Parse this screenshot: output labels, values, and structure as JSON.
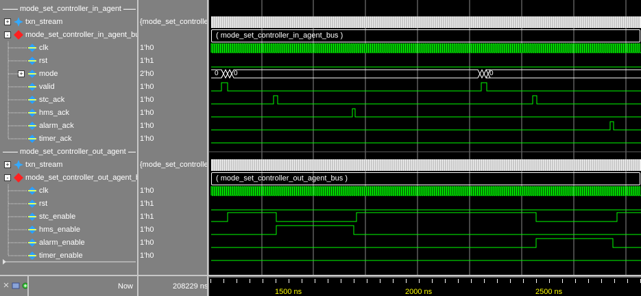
{
  "groups": [
    {
      "label": "mode_set_controller_in_agent"
    },
    {
      "label": "mode_set_controller_out_agent"
    }
  ],
  "signals": [
    {
      "name": "txn_stream",
      "value": "{mode_set_controller...",
      "icon": "stream-icon",
      "expand": "+"
    },
    {
      "name": "mode_set_controller_in_agent_bus",
      "value": "",
      "icon": "bus-icon",
      "expand": "-"
    },
    {
      "name": "clk",
      "value": "1'h0",
      "icon": "wire-icon"
    },
    {
      "name": "rst",
      "value": "1'h1",
      "icon": "wire-icon"
    },
    {
      "name": "mode",
      "value": "2'h0",
      "icon": "wire-icon",
      "expand": "+"
    },
    {
      "name": "valid",
      "value": "1'h0",
      "icon": "wire-icon"
    },
    {
      "name": "stc_ack",
      "value": "1'h0",
      "icon": "wire-icon"
    },
    {
      "name": "hms_ack",
      "value": "1'h0",
      "icon": "wire-icon"
    },
    {
      "name": "alarm_ack",
      "value": "1'h0",
      "icon": "wire-icon"
    },
    {
      "name": "timer_ack",
      "value": "1'h0",
      "icon": "wire-icon"
    },
    {
      "name": "txn_stream",
      "value": "{mode_set_controlle...",
      "icon": "stream-icon",
      "expand": "+"
    },
    {
      "name": "mode_set_controller_out_agent_bus",
      "value": "",
      "icon": "bus-icon",
      "expand": "-"
    },
    {
      "name": "clk",
      "value": "1'h0",
      "icon": "wire-icon"
    },
    {
      "name": "rst",
      "value": "1'h1",
      "icon": "wire-icon"
    },
    {
      "name": "stc_enable",
      "value": "1'h1",
      "icon": "wire-icon"
    },
    {
      "name": "hms_enable",
      "value": "1'h0",
      "icon": "wire-icon"
    },
    {
      "name": "alarm_enable",
      "value": "1'h0",
      "icon": "wire-icon"
    },
    {
      "name": "timer_enable",
      "value": "1'h0",
      "icon": "wire-icon"
    }
  ],
  "wave_labels": {
    "in_bus": "( mode_set_controller_in_agent_bus )",
    "out_bus": "( mode_set_controller_out_agent_bus )",
    "mode_a": "0",
    "mode_b": "0",
    "mode_c": "0"
  },
  "status": {
    "now_label": "Now",
    "now_value": "208229 ns"
  },
  "timeline": {
    "labels": [
      "1500 ns",
      "2000 ns",
      "2500 ns"
    ]
  },
  "colors": {
    "wave": "#00ff00",
    "grid": "#ffffff",
    "axis_label": "#ffff00",
    "bus_icon": "#ff0000",
    "wire_icon": "#00a0ff"
  }
}
